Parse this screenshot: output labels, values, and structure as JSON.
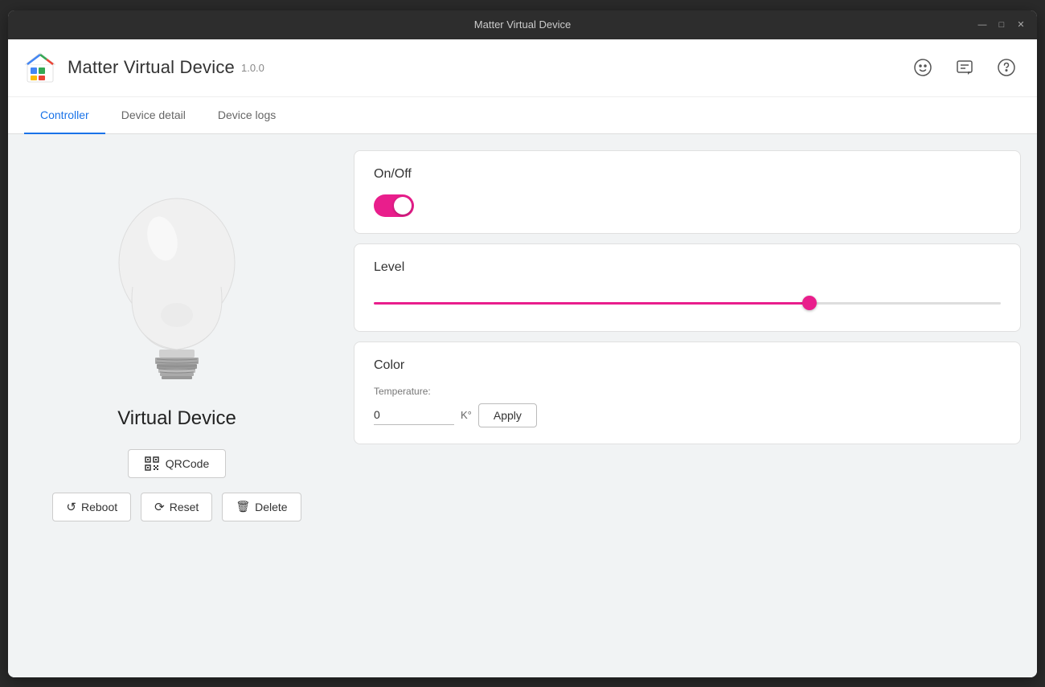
{
  "titlebar": {
    "title": "Matter Virtual Device",
    "controls": {
      "minimize": "—",
      "maximize": "□",
      "close": "✕"
    }
  },
  "header": {
    "app_title": "Matter Virtual Device",
    "version": "1.0.0",
    "icons": {
      "emoji": "☺",
      "feedback": "⊡",
      "help": "?"
    }
  },
  "tabs": [
    {
      "id": "controller",
      "label": "Controller",
      "active": true
    },
    {
      "id": "device-detail",
      "label": "Device detail",
      "active": false
    },
    {
      "id": "device-logs",
      "label": "Device logs",
      "active": false
    }
  ],
  "left_panel": {
    "device_name": "Virtual Device",
    "qrcode_btn_label": "QRCode",
    "action_buttons": [
      {
        "id": "reboot",
        "label": "Reboot",
        "icon": "↺"
      },
      {
        "id": "reset",
        "label": "Reset",
        "icon": "⟳"
      },
      {
        "id": "delete",
        "label": "Delete",
        "icon": "🗑"
      }
    ]
  },
  "controls": {
    "on_off": {
      "label": "On/Off",
      "state": true
    },
    "level": {
      "label": "Level",
      "value": 70,
      "min": 0,
      "max": 100
    },
    "color": {
      "label": "Color",
      "temperature_label": "Temperature:",
      "temperature_value": "0",
      "temperature_unit": "K°",
      "apply_label": "Apply"
    }
  }
}
